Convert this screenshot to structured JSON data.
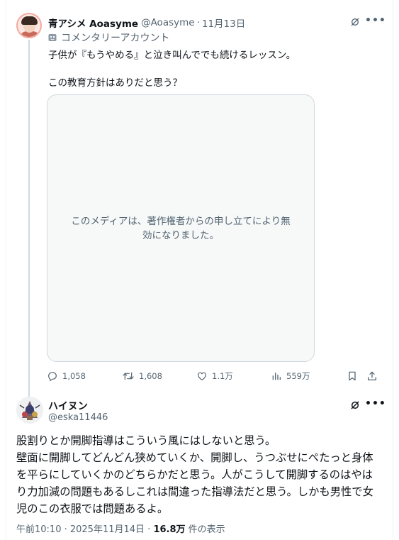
{
  "tweet": {
    "author_name": "青アシメ Aoasyme",
    "author_handle": "@Aoasyme",
    "separator": "·",
    "date": "11月13日",
    "commentary_label": "コメンタリーアカウント",
    "text_lines": [
      "子供が『もうやめる』と泣き叫んででも続けるレッスン。",
      "この教育方針はありだと思う？"
    ],
    "media_notice": "このメディアは、著作権者からの申し立てにより無効になりました。",
    "stats": {
      "replies": "1,058",
      "reposts": "1,608",
      "likes": "1.1万",
      "views": "559万"
    }
  },
  "reply": {
    "author_name": "ハイヌン",
    "author_handle": "@eska11446",
    "text_lines": [
      "股割りとか開脚指導はこういう風にはしないと思う。",
      "壁面に開脚してどんどん狭めていくか、開脚し、うつぶせにぺたっと身体",
      "を平らにしていくかのどちらかだと思う。人がこうして開脚するのはやは",
      "り力加減の問題もあるしこれは間違った指導法だと思う。しかも男性で女",
      "児のこの衣服では問題あるよ。"
    ],
    "timestamp": "午前10:10 · 2025年11月14日 · ",
    "views_count": "16.8万",
    "views_label": " 件の表示"
  },
  "icons": {
    "grok": "grok-icon",
    "more": "more-icon",
    "reply": "reply-icon",
    "repost": "repost-icon",
    "like": "heart-icon",
    "views": "views-icon",
    "bookmark": "bookmark-icon",
    "share": "share-icon",
    "commentary": "mask-icon"
  },
  "colors": {
    "text": "#0f1419",
    "secondary": "#536471",
    "border": "#cfd9de",
    "media_bg": "#f7f9f9"
  }
}
